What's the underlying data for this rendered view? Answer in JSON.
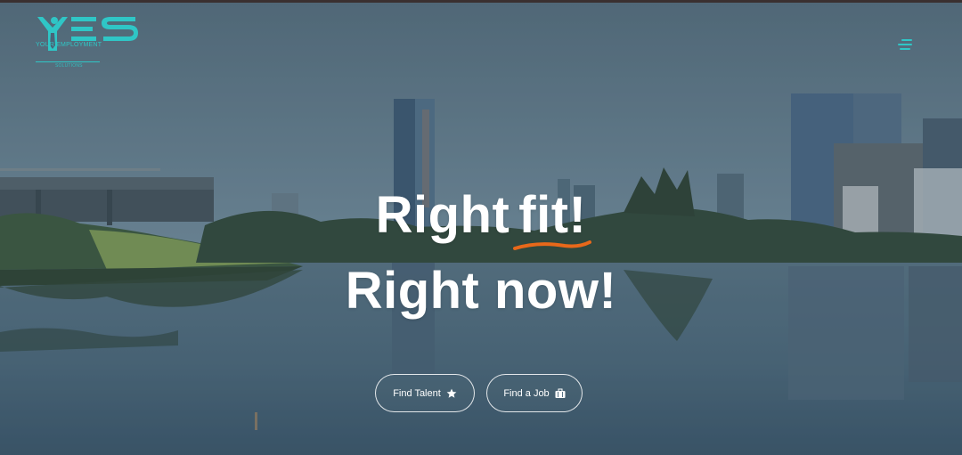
{
  "logo": {
    "mark": "YES",
    "line1": "YOUR EMPLOYMENT",
    "line2": "SOLUTIONS",
    "color": "#2fc6c6"
  },
  "nav": {
    "menu_icon": "hamburger-menu-icon"
  },
  "hero": {
    "headline_word1": "Right",
    "headline_word2": "fit!",
    "headline_line2": "Right now!",
    "accent_color": "#e8681a",
    "background_icon": "city-lake-skyline-photo"
  },
  "buttons": {
    "find_talent": "Find Talent",
    "find_talent_icon": "star-icon",
    "find_job": "Find a Job",
    "find_job_icon": "briefcase-icon"
  }
}
